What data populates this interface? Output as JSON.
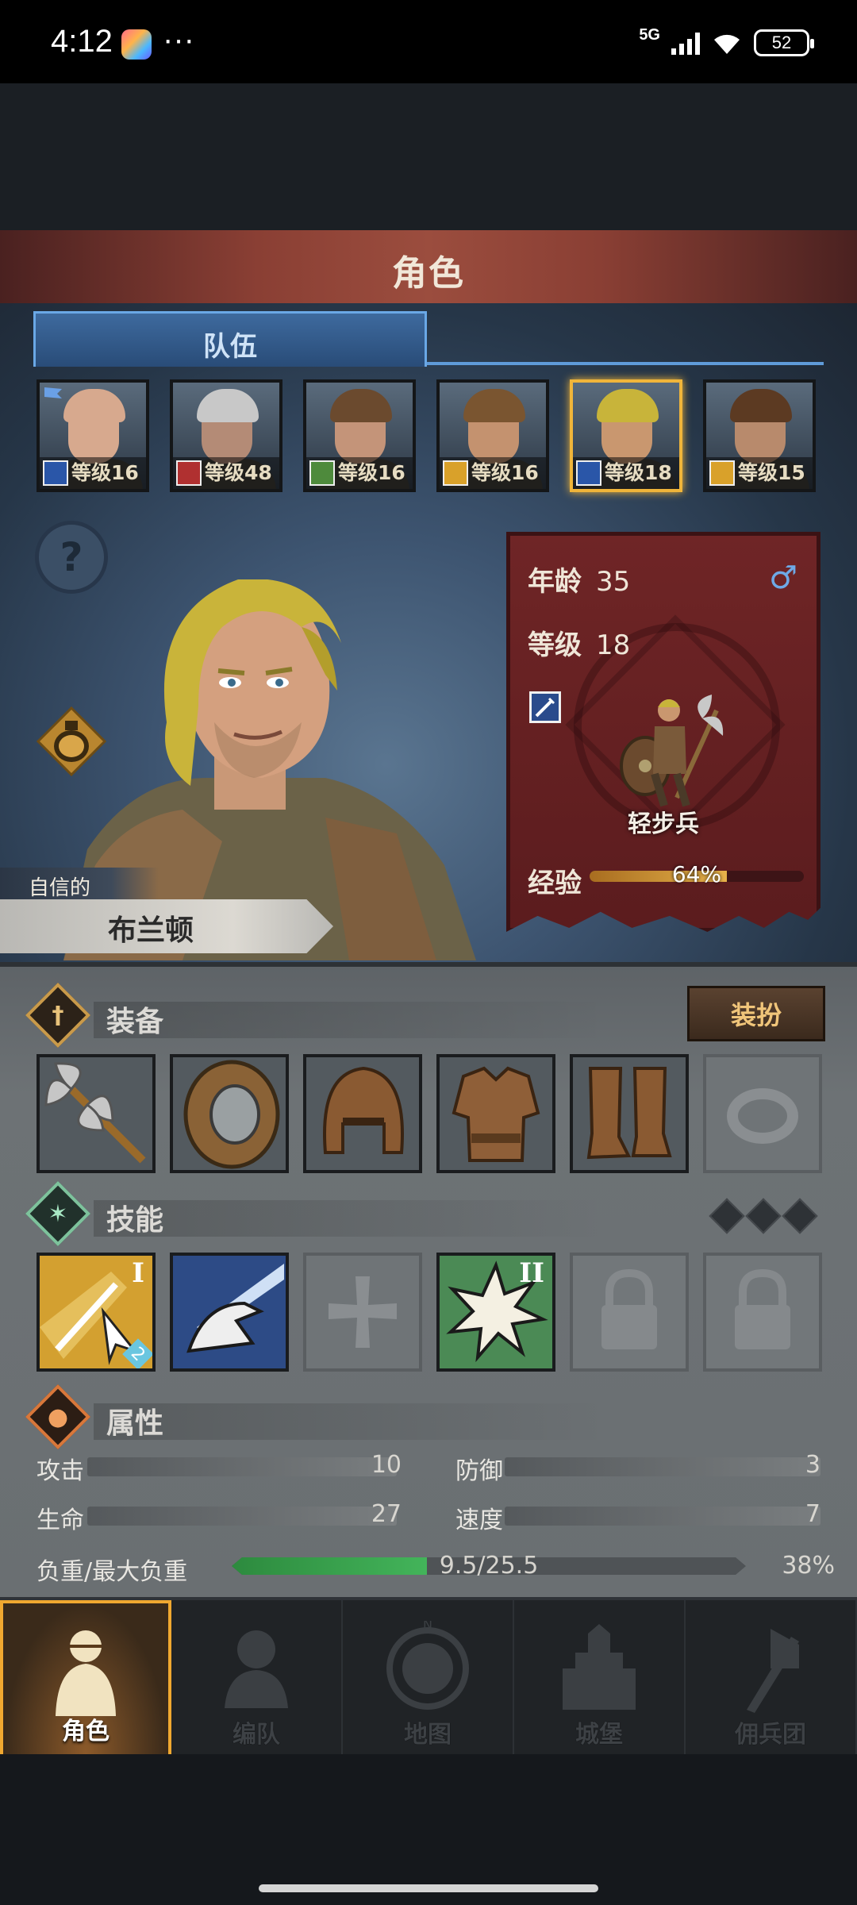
{
  "status_bar": {
    "time": "4:12",
    "more": "···",
    "network": "5G",
    "battery": "52"
  },
  "header": {
    "title": "角色"
  },
  "team": {
    "tab_label": "队伍",
    "members": [
      {
        "level": "等级16",
        "class_icon": "sword-icon",
        "class_color": "#2a56a8",
        "skin": "#d7a98e",
        "hair": "#d7a98e",
        "selected": false,
        "flag": true
      },
      {
        "level": "等级48",
        "class_icon": "horse-icon",
        "class_color": "#b03030",
        "skin": "#b48b76",
        "hair": "#c8c8c8",
        "selected": false
      },
      {
        "level": "等级16",
        "class_icon": "crossbow-icon",
        "class_color": "#4e8a3c",
        "skin": "#c49479",
        "hair": "#6b4a2e",
        "selected": false
      },
      {
        "level": "等级16",
        "class_icon": "shield-icon",
        "class_color": "#d9a12a",
        "skin": "#c4926f",
        "hair": "#7a5530",
        "selected": false
      },
      {
        "level": "等级18",
        "class_icon": "sword-icon",
        "class_color": "#2a56a8",
        "skin": "#c9976f",
        "hair": "#c8b43a",
        "selected": true
      },
      {
        "level": "等级15",
        "class_icon": "shield-icon",
        "class_color": "#d9a12a",
        "skin": "#b88a6c",
        "hair": "#5c3a22",
        "selected": false
      }
    ]
  },
  "character": {
    "trait": "自信的",
    "name": "布兰顿",
    "age_label": "年龄",
    "age": "35",
    "gender_symbol": "♂",
    "level_label": "等级",
    "level": "18",
    "unit_class": "轻步兵",
    "exp_label": "经验",
    "exp_percent": "64%",
    "exp_value": 0.64
  },
  "equipment": {
    "title": "装备",
    "dress_button": "装扮",
    "slots": [
      "axe-icon",
      "shield-icon",
      "helmet-icon",
      "armor-icon",
      "boots-icon",
      "ring-slot-empty"
    ]
  },
  "skills": {
    "title": "技能",
    "slots": [
      {
        "icon": "sword-strike-skill-icon",
        "tier": "I",
        "badge": "2"
      },
      {
        "icon": "eagle-charge-skill-icon",
        "tier": ""
      },
      {
        "icon": "cross-slot-empty",
        "tier": ""
      },
      {
        "icon": "burst-skill-icon",
        "tier": "II"
      },
      {
        "icon": "lock-icon",
        "tier": ""
      },
      {
        "icon": "lock-icon",
        "tier": ""
      }
    ]
  },
  "attributes": {
    "title": "属性",
    "attack_label": "攻击",
    "attack": "10",
    "defense_label": "防御",
    "defense": "3",
    "hp_label": "生命",
    "hp": "27",
    "speed_label": "速度",
    "speed": "7",
    "load_label": "负重/最大负重",
    "load_text": "9.5/25.5",
    "load_percent": "38%",
    "load_value": 0.38
  },
  "navbar": {
    "items": [
      {
        "label": "角色",
        "icon": "knight-icon",
        "active": true
      },
      {
        "label": "编队",
        "icon": "formation-icon",
        "active": false
      },
      {
        "label": "地图",
        "icon": "map-compass-icon",
        "active": false
      },
      {
        "label": "城堡",
        "icon": "castle-icon",
        "active": false
      },
      {
        "label": "佣兵团",
        "icon": "mercenary-flag-icon",
        "active": false
      }
    ]
  }
}
